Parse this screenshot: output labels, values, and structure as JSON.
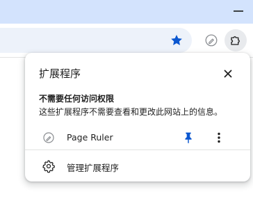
{
  "popup": {
    "title": "扩展程序",
    "section_heading": "不需要任何访问权限",
    "section_description": "这些扩展程序不需要查看和更改此网站上的信息。",
    "extensions": [
      {
        "name": "Page Ruler",
        "pinned": true
      }
    ],
    "manage_label": "管理扩展程序"
  },
  "colors": {
    "accent": "#0b57d0",
    "titlebar": "#d3e3fd",
    "omnibox": "#edf2fa"
  },
  "icons": {
    "bookmark": "star-icon",
    "extensions_menu": "puzzle-icon",
    "close": "close-icon",
    "pin": "pin-icon",
    "more": "more-vert-icon",
    "manage": "gear-icon"
  }
}
